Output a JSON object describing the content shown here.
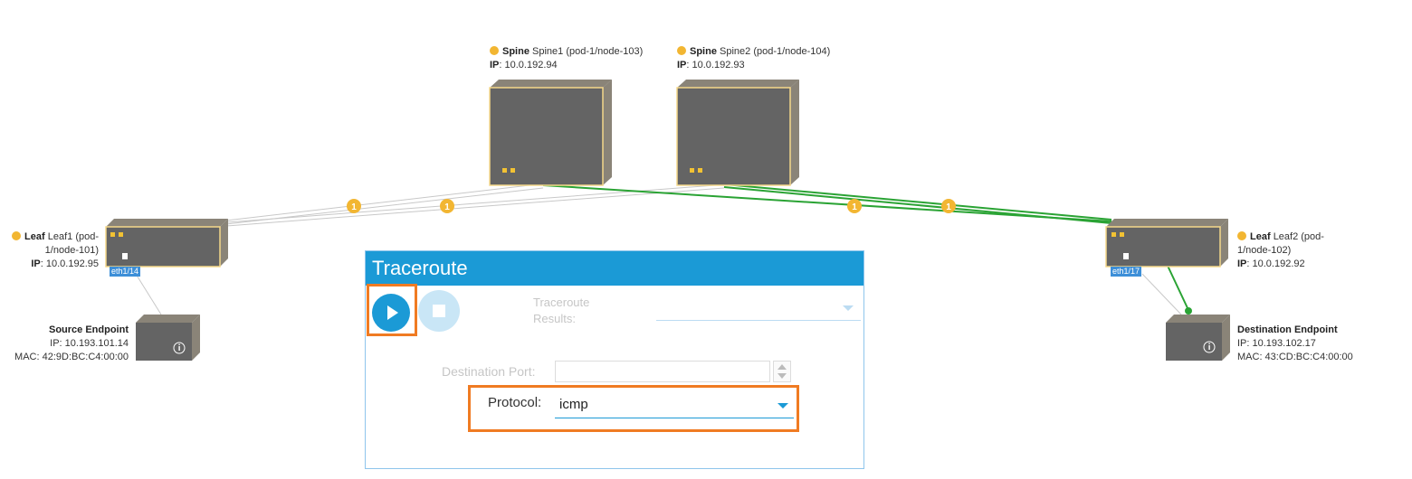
{
  "topology": {
    "spine1": {
      "type": "Spine",
      "name": "Spine1 (pod-1/node-103)",
      "ip_label": "IP",
      "ip": ": 10.0.192.94"
    },
    "spine2": {
      "type": "Spine",
      "name": "Spine2 (pod-1/node-104)",
      "ip_label": "IP",
      "ip": ": 10.0.192.93"
    },
    "leaf1": {
      "type": "Leaf",
      "name": "Leaf1 (pod-",
      "name2": "1/node-101)",
      "ip_label": "IP",
      "ip": ": 10.0.192.95",
      "port": "eth1/14"
    },
    "leaf2": {
      "type": "Leaf",
      "name": "Leaf2 (pod-",
      "name2": "1/node-102)",
      "ip_label": "IP",
      "ip": ": 10.0.192.92",
      "port": "eth1/17"
    },
    "source_endpoint": {
      "title": "Source Endpoint",
      "ip": "IP: 10.193.101.14",
      "mac": "MAC: 42:9D:BC:C4:00:00"
    },
    "destination_endpoint": {
      "title": "Destination Endpoint",
      "ip": "IP: 10.193.102.17",
      "mac": "MAC: 43:CD:BC:C4:00:00"
    },
    "link_badges": [
      "1",
      "1",
      "1",
      "1"
    ],
    "colors": {
      "device": "#646464",
      "device_border": "#f5d88a",
      "path_green": "#2aa334",
      "link_gray": "#c8c8c8",
      "warning": "#f2b632"
    }
  },
  "traceroute": {
    "title": "Traceroute",
    "results_label": "Traceroute Results:",
    "destination_port_label": "Destination Port:",
    "destination_port_value": "",
    "protocol_label": "Protocol:",
    "protocol_value": "icmp",
    "icons": {
      "run": "play-icon",
      "stop": "stop-icon"
    },
    "colors": {
      "header": "#1b9ad6",
      "highlight": "#f07b22"
    }
  }
}
